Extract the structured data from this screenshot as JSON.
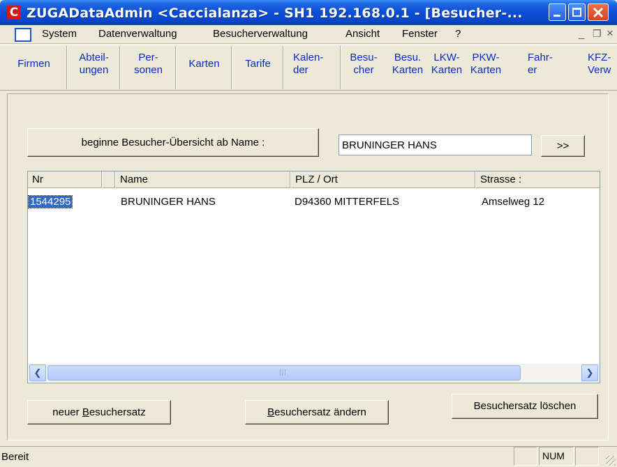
{
  "window": {
    "app_icon_letter": "C",
    "title": "ZUGADataAdmin <Caccialanza> - SH1 192.168.0.1 - [Besucher-..."
  },
  "menu": [
    "System",
    "Datenverwaltung",
    "Besucherverwaltung",
    "Ansicht",
    "Fenster",
    "?"
  ],
  "toolbar": [
    "Firmen",
    "Abteil-\nungen",
    "Per-\nsonen",
    "Karten",
    "Tarife",
    "Kalen-\nder",
    "Besu-\ncher",
    "Besu.\nKarten",
    "LKW-\nKarten",
    "PKW-\nKarten",
    "Fahr-\ner",
    "KFZ-\nVerw"
  ],
  "search": {
    "begin_button": "beginne Besucher-Übersicht  ab Name :",
    "name_value": "BRUNINGER HANS",
    "go_button": ">>"
  },
  "list": {
    "columns": [
      "Nr",
      "Name",
      "PLZ / Ort",
      "Strasse :"
    ],
    "rows": [
      {
        "nr": "1544295",
        "name": "BRUNINGER HANS",
        "plz_ort": "D94360 MITTERFELS",
        "strasse": "Amselweg 12"
      }
    ]
  },
  "actions": {
    "new_prefix": "neuer ",
    "new_accel": "B",
    "new_rest": "esuchersatz",
    "edit_accel": "B",
    "edit_rest": "esuchersatz ändern",
    "delete": "Besuchersatz löschen"
  },
  "status": {
    "text": "Bereit",
    "num": "NUM"
  }
}
